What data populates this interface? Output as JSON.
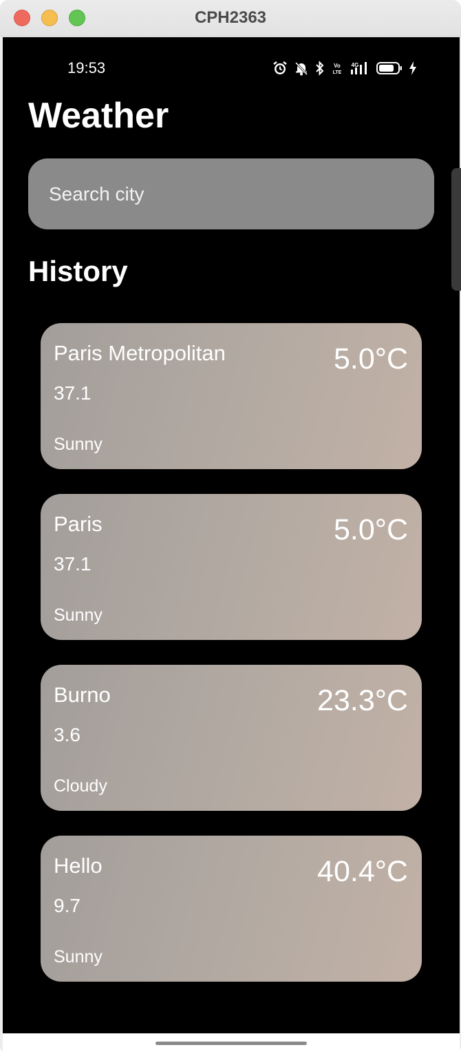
{
  "window": {
    "title": "CPH2363"
  },
  "status_bar": {
    "time": "19:53",
    "icons": [
      "alarm-icon",
      "bell-off-icon",
      "bluetooth-icon",
      "volte-icon",
      "4g-signal-icon",
      "battery-icon",
      "charging-icon"
    ],
    "volte_label": "Vo LTE",
    "network_label": "4G"
  },
  "header": {
    "title": "Weather"
  },
  "search": {
    "placeholder": "Search city",
    "value": ""
  },
  "history": {
    "title": "History",
    "items": [
      {
        "city": "Paris Metropolitan",
        "temperature": "5.0°C",
        "value": "37.1",
        "condition": "Sunny"
      },
      {
        "city": "Paris",
        "temperature": "5.0°C",
        "value": "37.1",
        "condition": "Sunny"
      },
      {
        "city": "Burno",
        "temperature": "23.3°C",
        "value": "3.6",
        "condition": "Cloudy"
      },
      {
        "city": "Hello",
        "temperature": "40.4°C",
        "value": "9.7",
        "condition": "Sunny"
      }
    ]
  },
  "colors": {
    "background": "#000000",
    "search_fill": "#8a8a8a",
    "card_gradient_start": "#a39e9b",
    "card_gradient_end": "#c2b1a6",
    "text": "#ffffff"
  }
}
